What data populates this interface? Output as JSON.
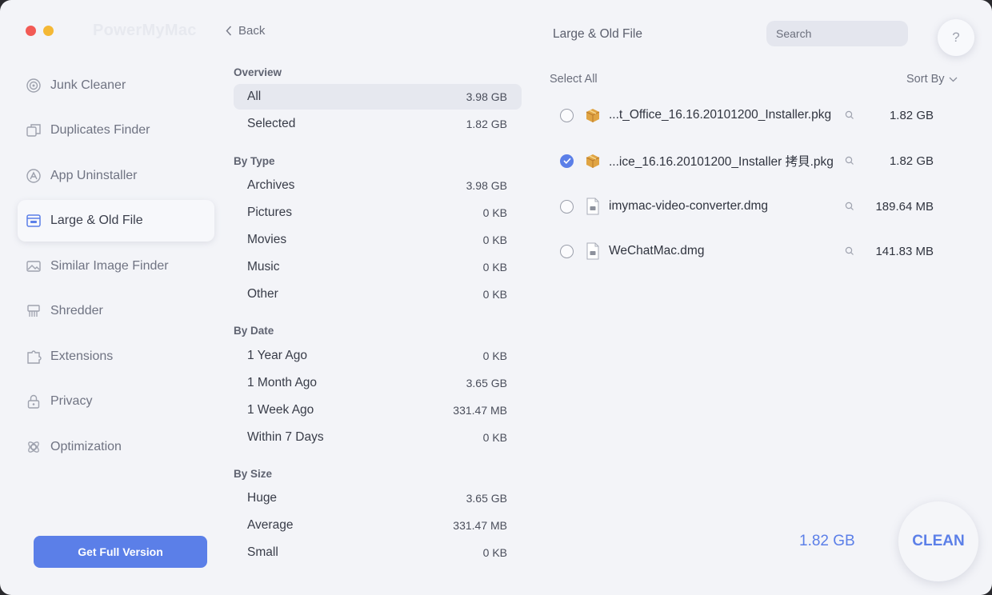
{
  "app": {
    "brand": "PowerMyMac"
  },
  "sidebar": {
    "items": [
      {
        "label": "Junk Cleaner",
        "icon": "junk-cleaner-icon"
      },
      {
        "label": "Duplicates Finder",
        "icon": "duplicates-icon"
      },
      {
        "label": "App Uninstaller",
        "icon": "app-uninstaller-icon"
      },
      {
        "label": "Large & Old File",
        "icon": "large-file-icon",
        "active": true
      },
      {
        "label": "Similar Image Finder",
        "icon": "image-icon"
      },
      {
        "label": "Shredder",
        "icon": "shredder-icon"
      },
      {
        "label": "Extensions",
        "icon": "extensions-icon"
      },
      {
        "label": "Privacy",
        "icon": "lock-icon"
      },
      {
        "label": "Optimization",
        "icon": "optimization-icon"
      }
    ],
    "full_version_label": "Get Full Version"
  },
  "middle": {
    "back_label": "Back",
    "overview": {
      "heading": "Overview",
      "rows": [
        {
          "label": "All",
          "value": "3.98 GB",
          "selected": true
        },
        {
          "label": "Selected",
          "value": "1.82 GB"
        }
      ]
    },
    "by_type": {
      "heading": "By Type",
      "rows": [
        {
          "label": "Archives",
          "value": "3.98 GB"
        },
        {
          "label": "Pictures",
          "value": "0 KB"
        },
        {
          "label": "Movies",
          "value": "0 KB"
        },
        {
          "label": "Music",
          "value": "0 KB"
        },
        {
          "label": "Other",
          "value": "0 KB"
        }
      ]
    },
    "by_date": {
      "heading": "By Date",
      "rows": [
        {
          "label": "1 Year Ago",
          "value": "0 KB"
        },
        {
          "label": "1 Month Ago",
          "value": "3.65 GB"
        },
        {
          "label": "1 Week Ago",
          "value": "331.47 MB"
        },
        {
          "label": "Within 7 Days",
          "value": "0 KB"
        }
      ]
    },
    "by_size": {
      "heading": "By Size",
      "rows": [
        {
          "label": "Huge",
          "value": "3.65 GB"
        },
        {
          "label": "Average",
          "value": "331.47 MB"
        },
        {
          "label": "Small",
          "value": "0 KB"
        }
      ]
    }
  },
  "right": {
    "title": "Large & Old File",
    "search_placeholder": "Search",
    "help_label": "?",
    "select_all_label": "Select All",
    "sort_by_label": "Sort By",
    "files": [
      {
        "name": "...t_Office_16.16.20101200_Installer.pkg",
        "size": "1.82 GB",
        "checked": false,
        "icon": "package-icon"
      },
      {
        "name": "...ice_16.16.20101200_Installer 拷貝.pkg",
        "size": "1.82 GB",
        "checked": true,
        "icon": "package-icon"
      },
      {
        "name": "imymac-video-converter.dmg",
        "size": "189.64 MB",
        "checked": false,
        "icon": "disk-image-icon"
      },
      {
        "name": "WeChatMac.dmg",
        "size": "141.83 MB",
        "checked": false,
        "icon": "disk-image-icon"
      }
    ],
    "total_size": "1.82 GB",
    "clean_label": "CLEAN"
  },
  "colors": {
    "accent": "#5b7fe8",
    "background": "#f3f4f8"
  }
}
